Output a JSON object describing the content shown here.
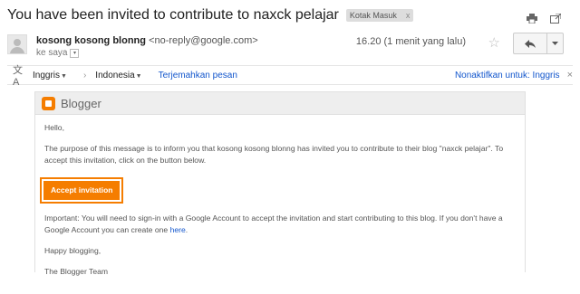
{
  "email": {
    "subject": "You have been invited to contribute to naxck pelajar",
    "label": "Kotak Masuk",
    "label_close": "x"
  },
  "sender": {
    "name": "kosong kosong blonng",
    "email": "<no-reply@google.com>",
    "to_me": "ke saya",
    "time": "16.20 (1 menit yang lalu)"
  },
  "translate": {
    "from_lang": "Inggris",
    "to_lang": "Indonesia",
    "translate_link": "Terjemahkan pesan",
    "disable_link": "Nonaktifkan untuk: Inggris",
    "close": "×"
  },
  "card": {
    "brand": "Blogger",
    "greeting": "Hello,",
    "paragraph1": "The purpose of this message is to inform you that kosong kosong blonng has invited you to contribute to their blog \"naxck pelajar\". To accept this invitation, click on the button below.",
    "button": "Accept invitation",
    "paragraph2": "Important: You will need to sign-in with a Google Account to accept the invitation and start contributing to this blog. If you don't have a Google Account you can create one",
    "here_link": "here",
    "period": ".",
    "signoff": "Happy blogging,",
    "team": "The Blogger Team"
  },
  "colors": {
    "accent": "#f57d00",
    "link": "#1155cc"
  }
}
